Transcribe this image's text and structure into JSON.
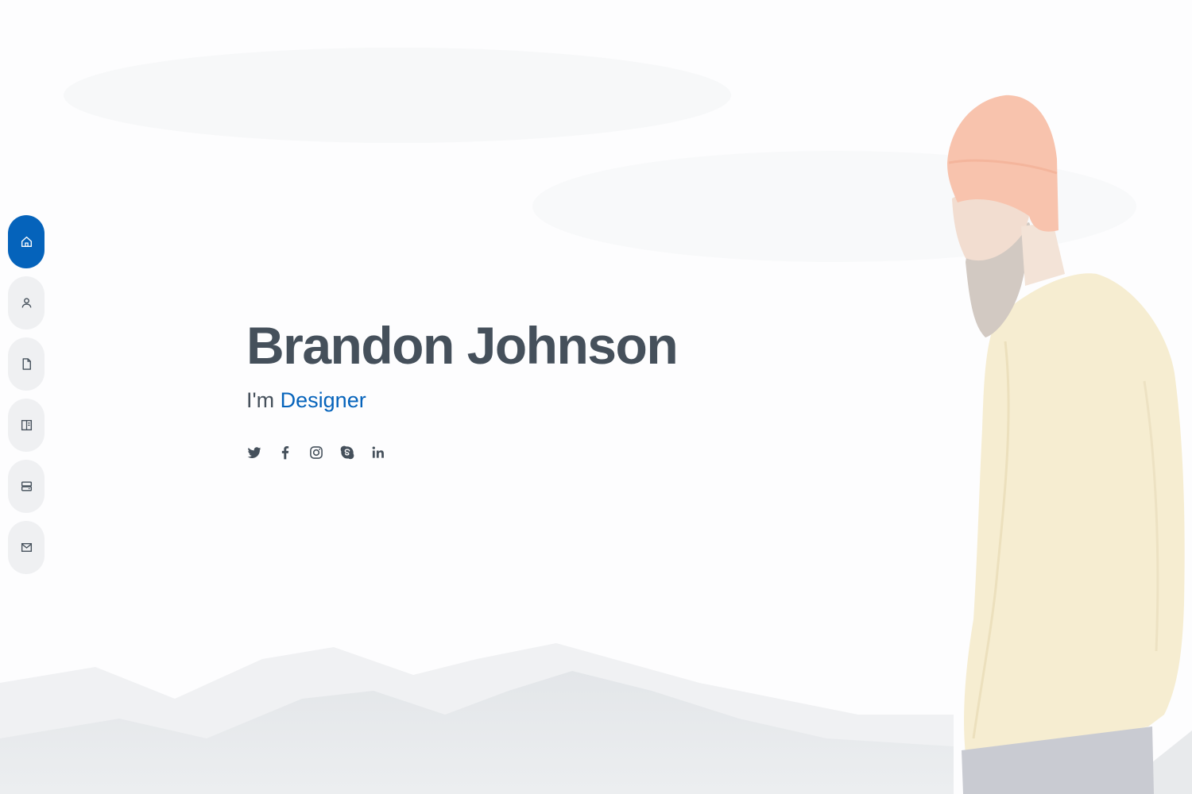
{
  "nav": {
    "items": [
      {
        "id": "home",
        "icon": "home-icon",
        "active": true
      },
      {
        "id": "about",
        "icon": "person-icon",
        "active": false
      },
      {
        "id": "resume",
        "icon": "file-icon",
        "active": false
      },
      {
        "id": "portfolio",
        "icon": "book-icon",
        "active": false
      },
      {
        "id": "services",
        "icon": "server-icon",
        "active": false
      },
      {
        "id": "contact",
        "icon": "envelope-icon",
        "active": false
      }
    ]
  },
  "hero": {
    "name": "Brandon Johnson",
    "tagline_prefix": "I'm ",
    "tagline_role": "Designer"
  },
  "social": [
    {
      "id": "twitter",
      "icon": "twitter-icon"
    },
    {
      "id": "facebook",
      "icon": "facebook-icon"
    },
    {
      "id": "instagram",
      "icon": "instagram-icon"
    },
    {
      "id": "skype",
      "icon": "skype-icon"
    },
    {
      "id": "linkedin",
      "icon": "linkedin-icon"
    }
  ],
  "colors": {
    "accent": "#0563bb",
    "text": "#45505b",
    "nav_bg": "#eff0f2"
  }
}
